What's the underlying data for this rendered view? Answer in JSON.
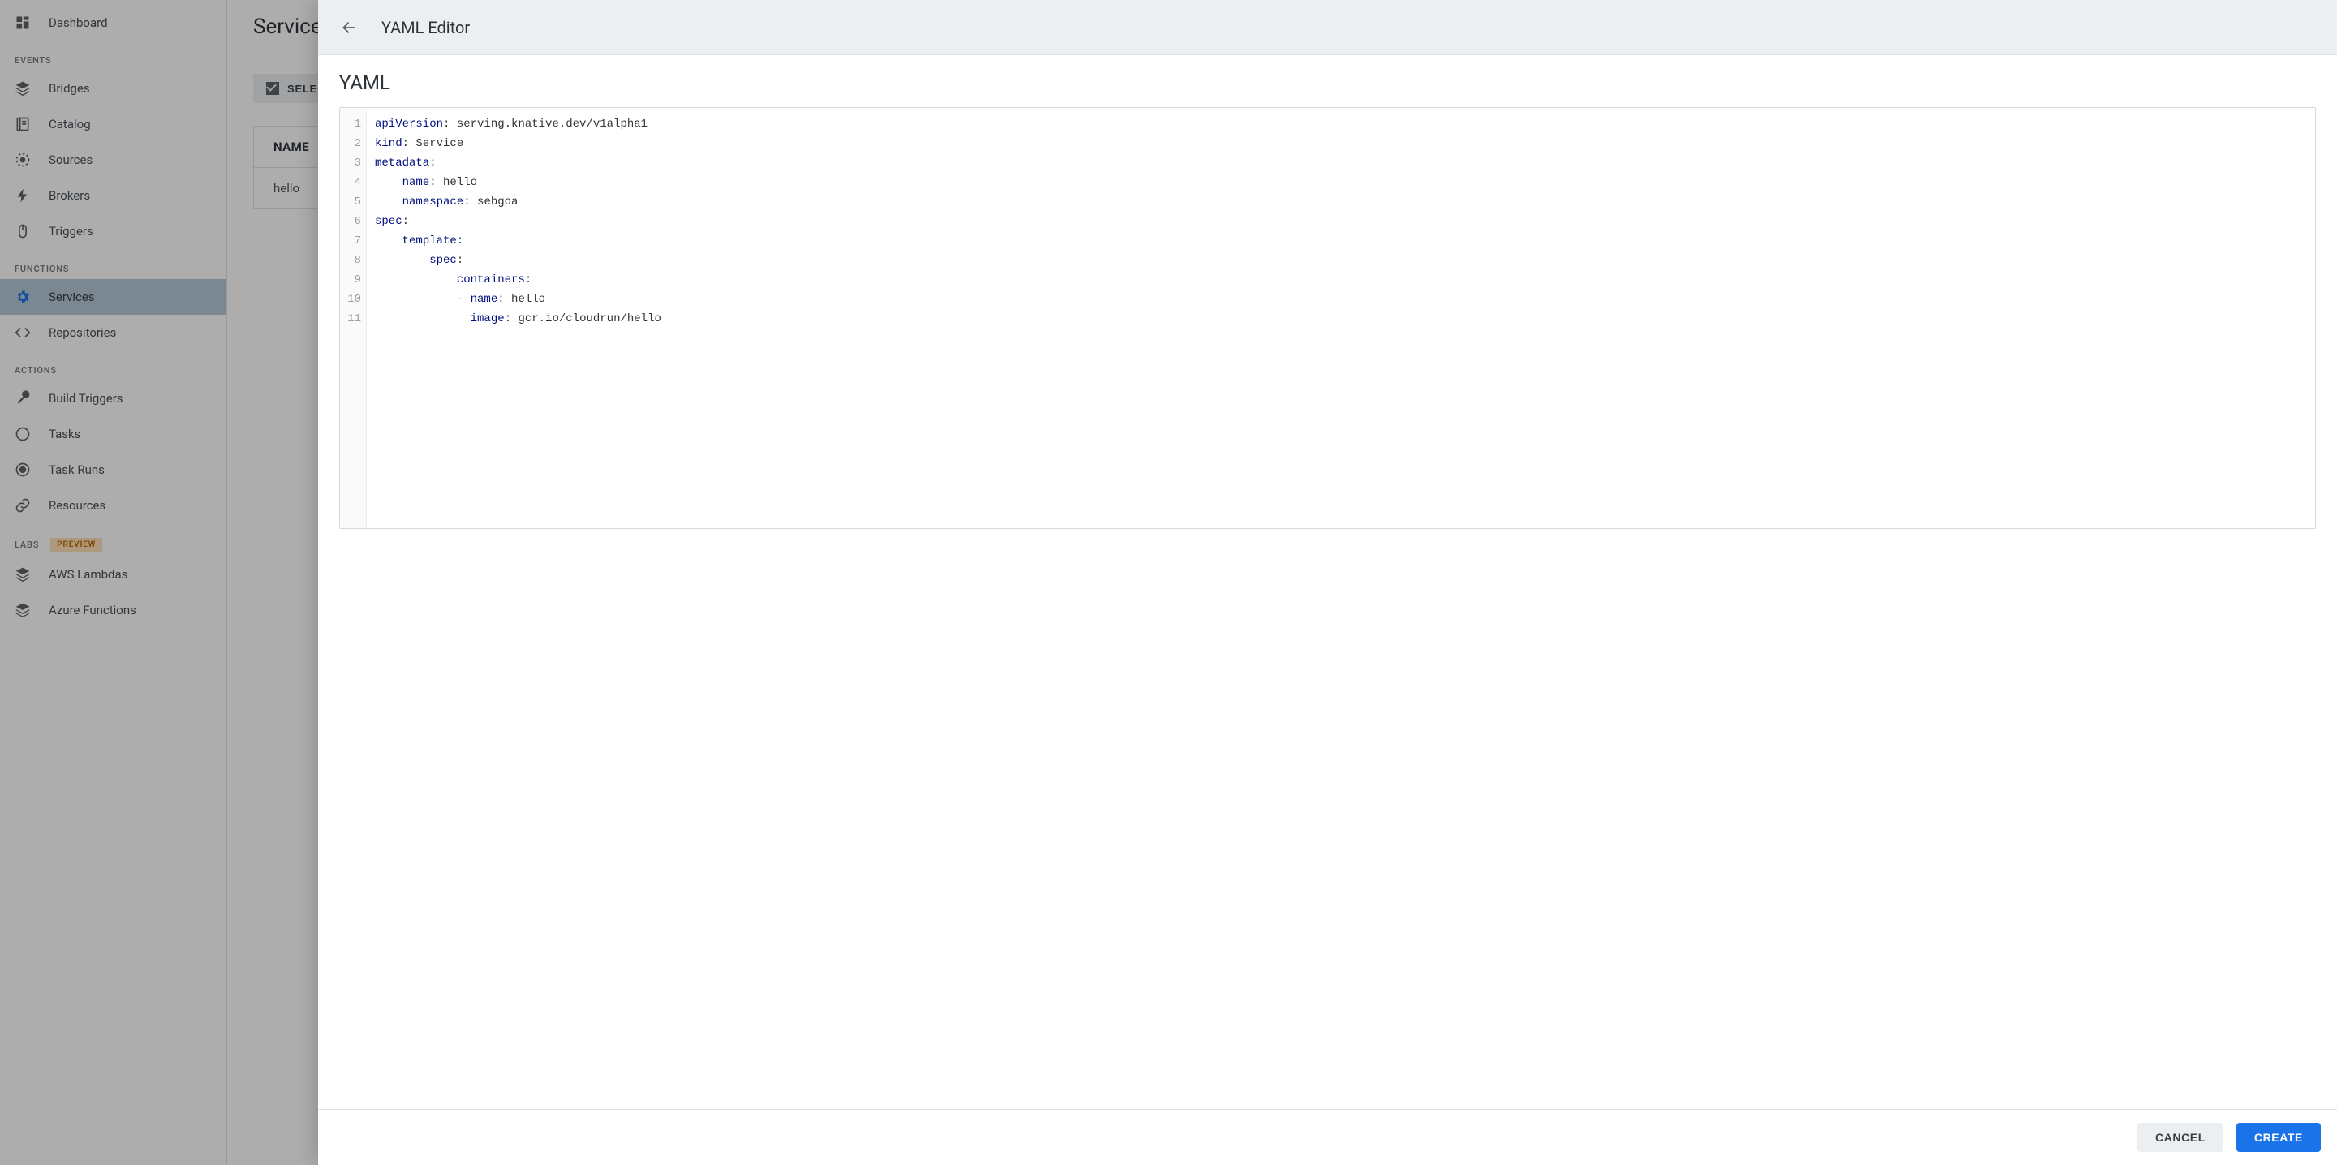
{
  "sidebar": {
    "top": {
      "label": "Dashboard",
      "icon": "dashboard-icon"
    },
    "sections": [
      {
        "heading": "EVENTS",
        "items": [
          {
            "label": "Bridges",
            "icon": "layers-icon"
          },
          {
            "label": "Catalog",
            "icon": "book-icon"
          },
          {
            "label": "Sources",
            "icon": "target-dashed-icon"
          },
          {
            "label": "Brokers",
            "icon": "bolt-icon"
          },
          {
            "label": "Triggers",
            "icon": "mouse-icon"
          }
        ]
      },
      {
        "heading": "FUNCTIONS",
        "items": [
          {
            "label": "Services",
            "icon": "gear-icon",
            "active": true
          },
          {
            "label": "Repositories",
            "icon": "code-icon"
          }
        ]
      },
      {
        "heading": "ACTIONS",
        "items": [
          {
            "label": "Build Triggers",
            "icon": "wrench-icon"
          },
          {
            "label": "Tasks",
            "icon": "circle-outline-icon"
          },
          {
            "label": "Task Runs",
            "icon": "target-icon"
          },
          {
            "label": "Resources",
            "icon": "link-icon"
          }
        ]
      },
      {
        "heading": "LABS",
        "badge": "PREVIEW",
        "items": [
          {
            "label": "AWS Lambdas",
            "icon": "layers-icon"
          },
          {
            "label": "Azure Functions",
            "icon": "layers-icon"
          }
        ]
      }
    ]
  },
  "main": {
    "title": "Services",
    "select_all_label": "SELECT ALL",
    "table": {
      "header": "NAME",
      "rows": [
        "hello"
      ]
    }
  },
  "drawer": {
    "title": "YAML Editor",
    "heading": "YAML",
    "code_lines": [
      [
        {
          "t": "key",
          "v": "apiVersion"
        },
        {
          "t": "punct",
          "v": ": "
        },
        {
          "t": "val",
          "v": "serving.knative.dev/v1alpha1"
        }
      ],
      [
        {
          "t": "key",
          "v": "kind"
        },
        {
          "t": "punct",
          "v": ": "
        },
        {
          "t": "val",
          "v": "Service"
        }
      ],
      [
        {
          "t": "key",
          "v": "metadata"
        },
        {
          "t": "punct",
          "v": ":"
        }
      ],
      [
        {
          "t": "punct",
          "v": "    "
        },
        {
          "t": "key",
          "v": "name"
        },
        {
          "t": "punct",
          "v": ": "
        },
        {
          "t": "val",
          "v": "hello"
        }
      ],
      [
        {
          "t": "punct",
          "v": "    "
        },
        {
          "t": "key",
          "v": "namespace"
        },
        {
          "t": "punct",
          "v": ": "
        },
        {
          "t": "val",
          "v": "sebgoa"
        }
      ],
      [
        {
          "t": "key",
          "v": "spec"
        },
        {
          "t": "punct",
          "v": ":"
        }
      ],
      [
        {
          "t": "punct",
          "v": "    "
        },
        {
          "t": "key",
          "v": "template"
        },
        {
          "t": "punct",
          "v": ":"
        }
      ],
      [
        {
          "t": "punct",
          "v": "        "
        },
        {
          "t": "key",
          "v": "spec"
        },
        {
          "t": "punct",
          "v": ":"
        }
      ],
      [
        {
          "t": "punct",
          "v": "            "
        },
        {
          "t": "key",
          "v": "containers"
        },
        {
          "t": "punct",
          "v": ":"
        }
      ],
      [
        {
          "t": "punct",
          "v": "            - "
        },
        {
          "t": "key",
          "v": "name"
        },
        {
          "t": "punct",
          "v": ": "
        },
        {
          "t": "val",
          "v": "hello"
        }
      ],
      [
        {
          "t": "punct",
          "v": "              "
        },
        {
          "t": "key",
          "v": "image"
        },
        {
          "t": "punct",
          "v": ": "
        },
        {
          "t": "val",
          "v": "gcr.io/cloudrun/hello"
        }
      ]
    ],
    "buttons": {
      "cancel": "CANCEL",
      "create": "CREATE"
    }
  }
}
